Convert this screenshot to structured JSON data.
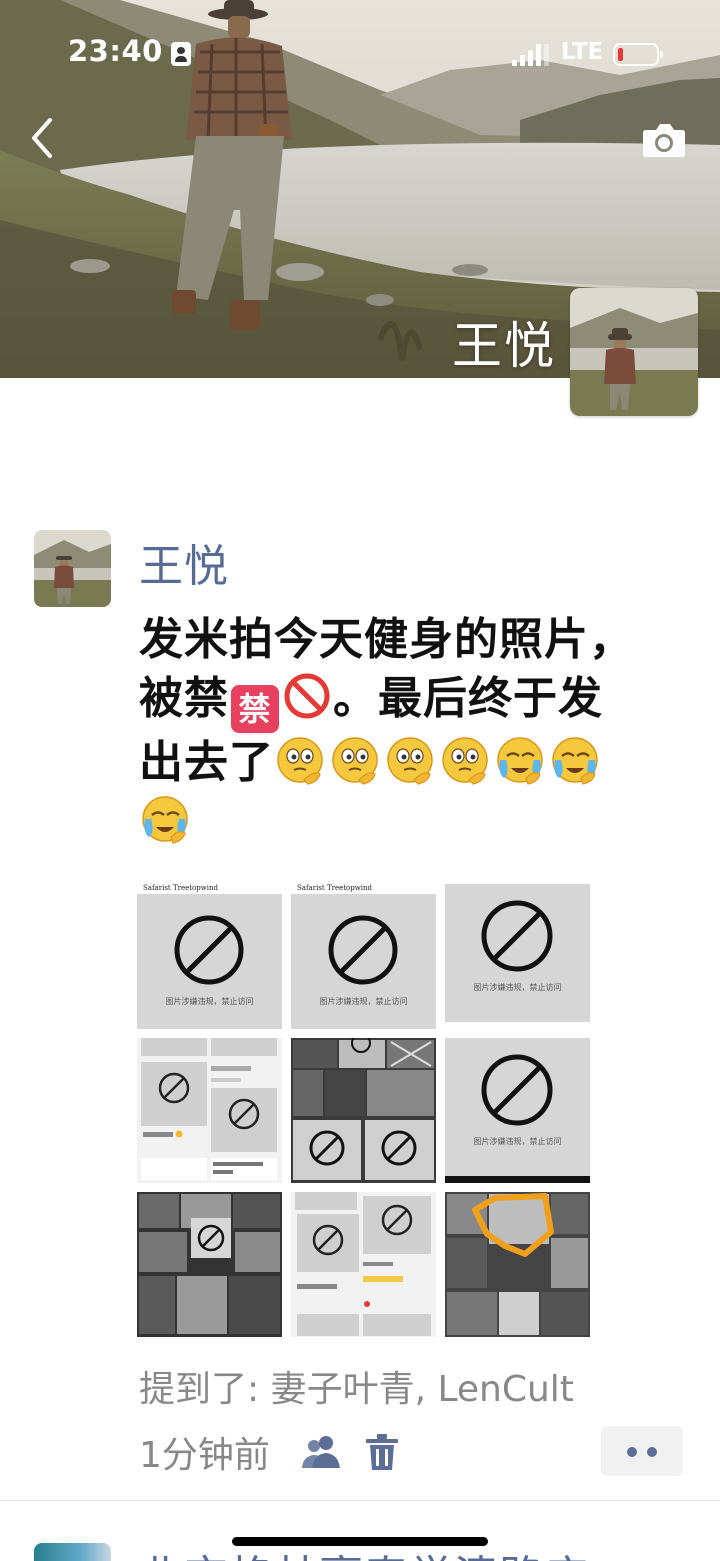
{
  "status_bar": {
    "time": "23:40",
    "network": "LTE"
  },
  "cover": {
    "name": "王悦",
    "icons": {
      "back": "chevron-left-icon",
      "camera": "camera-icon"
    }
  },
  "post": {
    "author": "王悦",
    "text_line1": "发米拍今天健身的照片，",
    "text_line2_a": "被禁",
    "text_line2_b": "。最后终于发",
    "text_line3": "出去了",
    "emoji_prohibited_glyph": "禁",
    "image_captions": [
      "图片涉嫌违规，禁止访问",
      "图片涉嫌违规，禁止访问",
      "图片涉嫌违规，禁止访问",
      "图片涉嫌违规，禁止访问"
    ],
    "image_header": "Safarist Treetopwind",
    "mention": "提到了: 妻子叶青, LenCult",
    "time": "1分钟前"
  },
  "next_post": {
    "author": "北京格林豪泰学清路店"
  },
  "colors": {
    "link": "#576b95",
    "secondary_text": "#888888",
    "battery_low": "#e53935"
  }
}
